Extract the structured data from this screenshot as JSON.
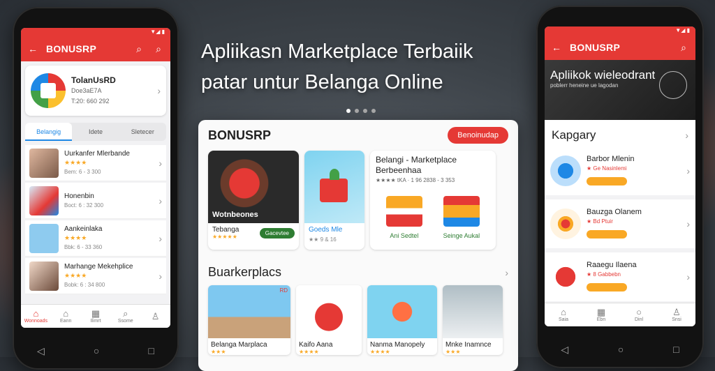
{
  "headline": {
    "line1": "Apliikasn Marketplace Terbaiik",
    "line2": "patar untur Belanga Online"
  },
  "left_phone": {
    "status": "▼◢ ▮",
    "app_title": "BONUSRP",
    "profile": {
      "name": "TolanUsRD",
      "line2": "Doe3aE7A",
      "line3": "T:20: 660 292"
    },
    "tabs": [
      "Belangig",
      "Idete",
      "Sletecer"
    ],
    "items": [
      {
        "title": "Uurkanfer Mlerbande",
        "meta": "Bem: 6 - 3 300"
      },
      {
        "title": "Honenbin",
        "meta": "Boct: 6 : 32 300"
      },
      {
        "title": "Aankeinlaka",
        "meta": "Bbk: 6 - 33 360"
      },
      {
        "title": "Marhange Mekehplice",
        "meta": "Bobk: 6 : 34 800"
      }
    ],
    "bottom_nav": [
      "Wonnoads",
      "Eann",
      "Ilimrt",
      "Ssome"
    ]
  },
  "center_panel": {
    "brand": "BONUSRP",
    "cta": "Benoinudap",
    "featured_card": {
      "overlay": "Wotnbeones",
      "caption": "Tebanga",
      "button": "Gacevtee"
    },
    "product_card": {
      "caption": "Goeds Mle",
      "meta": "★★ 9 & 16"
    },
    "info_card": {
      "title_line1": "Belangi - Marketplace",
      "title_line2": "Berbeenhaa",
      "rating_text": "★★★★ tKA ·  1 96 2838 - 3 353",
      "mini": [
        "Ani Sedtel",
        "Seinge Aukal"
      ]
    },
    "section_title": "Buarkerplacs",
    "market_cards": [
      {
        "caption": "Belanga Marplaca",
        "tag": "RD"
      },
      {
        "caption": "Kaifo Aana"
      },
      {
        "caption": "Nanma Manopely"
      },
      {
        "caption": "Mnke Inamnce"
      }
    ]
  },
  "right_phone": {
    "status": "▼◢ ▮",
    "app_title": "BONUSRP",
    "banner": {
      "title": "Apliikok wieleodrant",
      "subtitle": "poblerr heneine ue lagodan"
    },
    "category_title": "Kapgary",
    "categories": [
      {
        "title": "Barbor Mlenin",
        "sub": "★ Ge Nasinlemi"
      },
      {
        "title": "Bauzga Olanem",
        "sub": "★ Bd Ptuir"
      },
      {
        "title": "Raaegu Ilaena",
        "sub": "★ 8 Gabbebn"
      }
    ],
    "bottom_nav": [
      "Saia",
      "Ebn",
      "Dinl",
      "Snsi"
    ]
  },
  "colors": {
    "brand_red": "#e53935",
    "accent_green": "#2e7d32",
    "star_yellow": "#f9a825",
    "accent_blue": "#1e88e5"
  }
}
